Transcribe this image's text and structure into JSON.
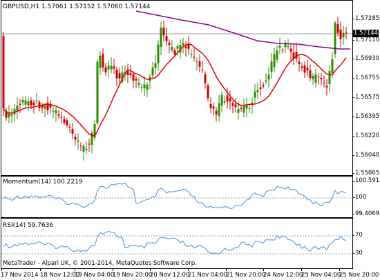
{
  "main": {
    "header": "GBPUSD,H1  1.57061 1.57152 1.57060 1.57144",
    "price_badge": "1.57144",
    "y_labels": [
      "1.57285",
      "1.57110",
      "1.56930",
      "1.56755",
      "1.56575",
      "1.56395",
      "1.56220",
      "1.56040",
      "1.55865"
    ]
  },
  "momentum": {
    "header": "Momentum(14) 100.2219",
    "y_labels": [
      "100.5915",
      "100",
      "99.4069"
    ]
  },
  "rsi": {
    "header": "RSI(14) 59.7636",
    "y_labels": [
      "70",
      "30"
    ]
  },
  "footer": "MetaTrader - Alpari UK, © 2001-2014, MetaQuotes Software Corp.",
  "x_labels": [
    "17 Nov 2014",
    "18 Nov 12:00",
    "19 Nov 04:00",
    "19 Nov 20:00",
    "20 Nov 12:00",
    "21 Nov 04:00",
    "21 Nov 20:00",
    "24 Nov 12:00",
    "25 Nov 04:00",
    "25 Nov 20:00"
  ],
  "colors": {
    "candle_up": "#2e8b00",
    "candle_down": "#cc0000",
    "sma_short": "#e00000",
    "sma_long": "#8b008b",
    "indicator_line": "#3d8fe0",
    "grid": "#7a7a7a"
  }
}
